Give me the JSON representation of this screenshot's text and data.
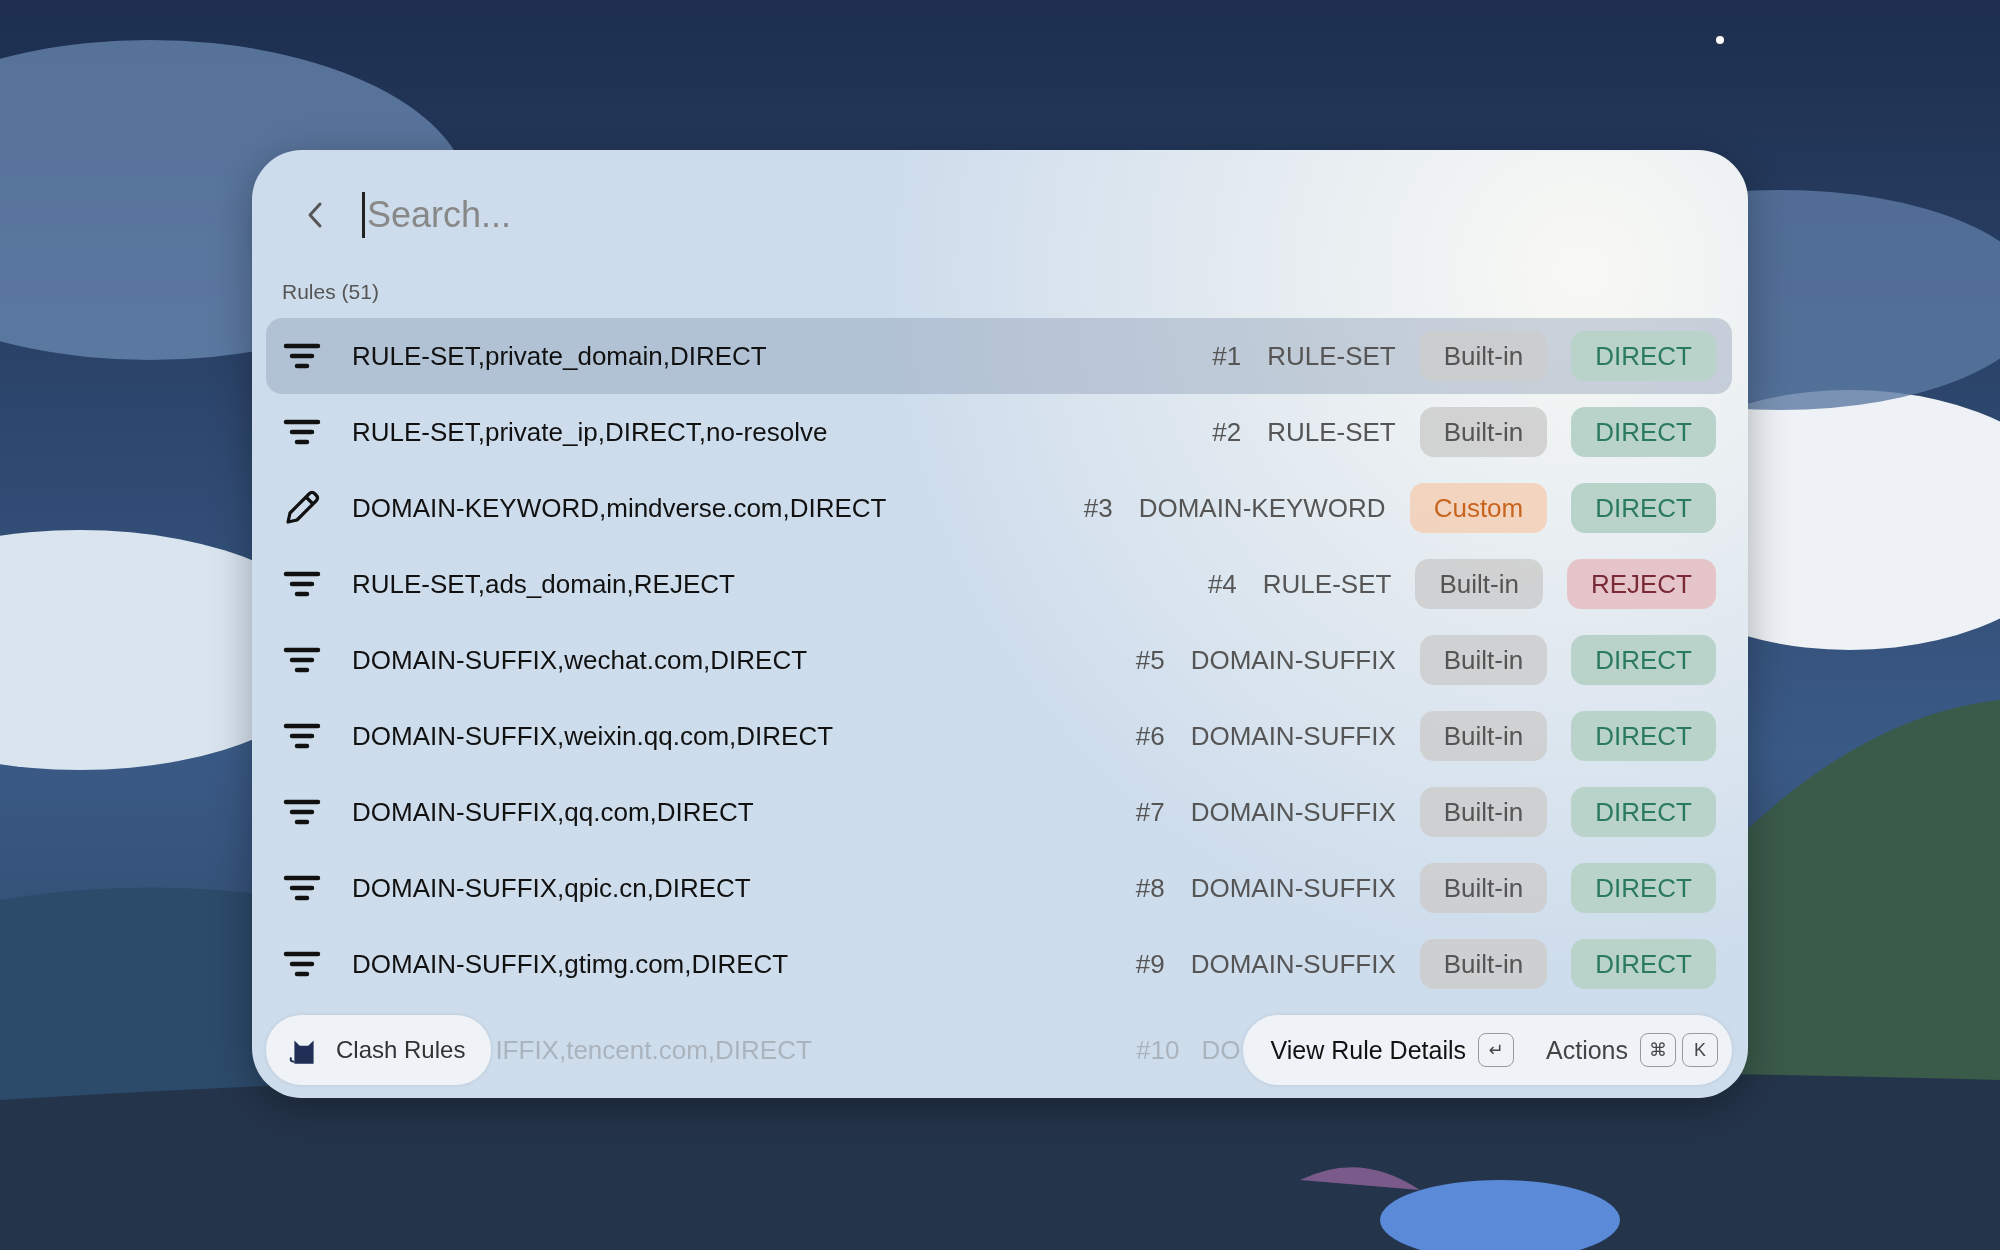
{
  "search": {
    "placeholder": "Search..."
  },
  "section": {
    "title": "Rules (51)"
  },
  "rules": [
    {
      "kind": "builtin",
      "label": "RULE-SET,private_domain,DIRECT",
      "number": "#1",
      "type": "RULE-SET",
      "source": "Built-in",
      "action": "DIRECT",
      "color": "#b9d3cb",
      "selected": true
    },
    {
      "kind": "builtin",
      "label": "RULE-SET,private_ip,DIRECT,no-resolve",
      "number": "#2",
      "type": "RULE-SET",
      "source": "Built-in",
      "action": "DIRECT",
      "color": "#b9d3cb",
      "selected": false
    },
    {
      "kind": "custom",
      "label": "DOMAIN-KEYWORD,mindverse.com,DIRECT",
      "number": "#3",
      "type": "DOMAIN-KEYWORD",
      "source": "Custom",
      "action": "DIRECT",
      "color": "#b9d3cb",
      "selected": false
    },
    {
      "kind": "builtin",
      "label": "RULE-SET,ads_domain,REJECT",
      "number": "#4",
      "type": "RULE-SET",
      "source": "Built-in",
      "action": "REJECT",
      "color": "#e6c5ca",
      "selected": false
    },
    {
      "kind": "builtin",
      "label": "DOMAIN-SUFFIX,wechat.com,DIRECT",
      "number": "#5",
      "type": "DOMAIN-SUFFIX",
      "source": "Built-in",
      "action": "DIRECT",
      "color": "#b9d3cb",
      "selected": false
    },
    {
      "kind": "builtin",
      "label": "DOMAIN-SUFFIX,weixin.qq.com,DIRECT",
      "number": "#6",
      "type": "DOMAIN-SUFFIX",
      "source": "Built-in",
      "action": "DIRECT",
      "color": "#b9d3cb",
      "selected": false
    },
    {
      "kind": "builtin",
      "label": "DOMAIN-SUFFIX,qq.com,DIRECT",
      "number": "#7",
      "type": "DOMAIN-SUFFIX",
      "source": "Built-in",
      "action": "DIRECT",
      "color": "#b9d3cb",
      "selected": false
    },
    {
      "kind": "builtin",
      "label": "DOMAIN-SUFFIX,qpic.cn,DIRECT",
      "number": "#8",
      "type": "DOMAIN-SUFFIX",
      "source": "Built-in",
      "action": "DIRECT",
      "color": "#b9d3cb",
      "selected": false
    },
    {
      "kind": "builtin",
      "label": "DOMAIN-SUFFIX,gtimg.com,DIRECT",
      "number": "#9",
      "type": "DOMAIN-SUFFIX",
      "source": "Built-in",
      "action": "DIRECT",
      "color": "#b9d3cb",
      "selected": false
    }
  ],
  "partial_rule": {
    "label": "IFFIX,tencent.com,DIRECT",
    "number": "#10",
    "type": "DO"
  },
  "footer": {
    "app": "Clash Rules",
    "primary_action": "View Rule Details",
    "primary_key": "↵",
    "secondary_action": "Actions",
    "secondary_keys": [
      "⌘",
      "K"
    ]
  }
}
